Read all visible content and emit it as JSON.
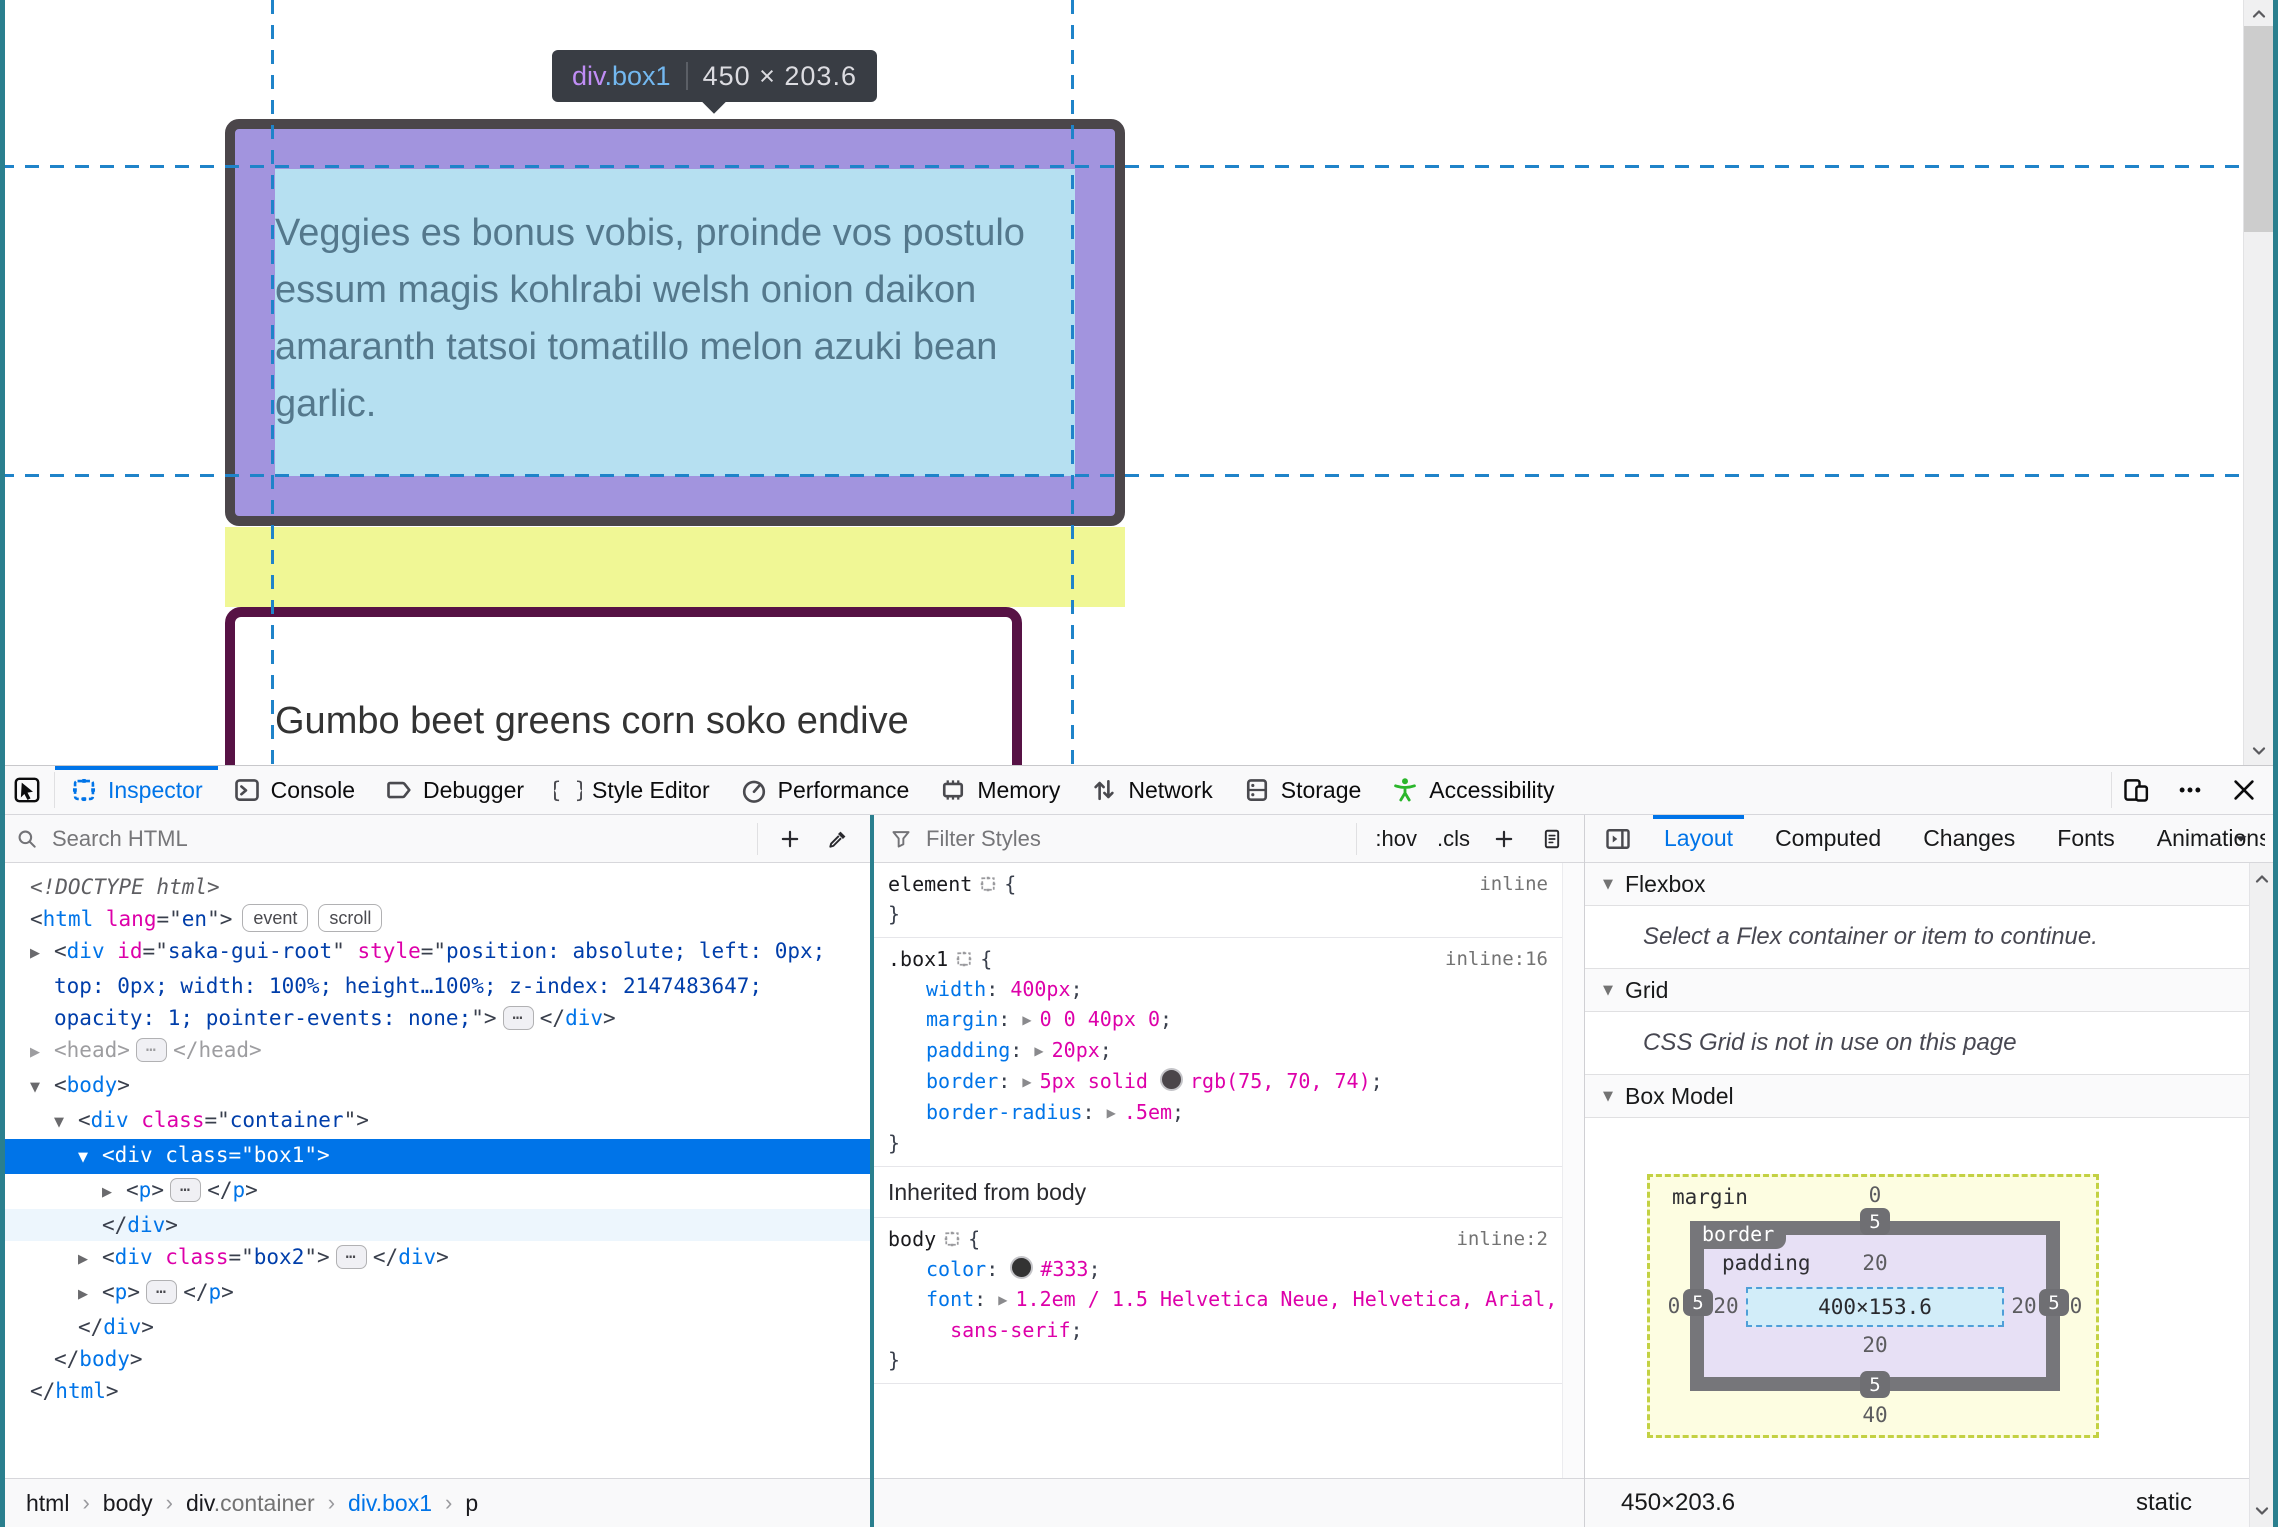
{
  "frame": {
    "edge_color": "#2a7f8e"
  },
  "page": {
    "tooltip": {
      "tag": "div",
      "class_name": ".box1",
      "size": "450 × 203.6"
    },
    "box1_text": "Veggies es bonus vobis, proinde vos postulo essum magis kohlrabi welsh onion daikon amaranth tatsoi tomatillo melon azuki bean garlic.",
    "box2_text": "Gumbo beet greens corn soko endive",
    "highlight_colors": {
      "padding": "#a294de",
      "content": "#b6e0f1",
      "margin": "#f0f795",
      "guide": "#1f83c9",
      "border": "#4b464a",
      "box2_border": "#571245"
    }
  },
  "toolbox": {
    "tabs": [
      {
        "id": "inspector",
        "label": "Inspector",
        "active": true
      },
      {
        "id": "console",
        "label": "Console"
      },
      {
        "id": "debugger",
        "label": "Debugger"
      },
      {
        "id": "style-editor",
        "label": "Style Editor"
      },
      {
        "id": "performance",
        "label": "Performance"
      },
      {
        "id": "memory",
        "label": "Memory"
      },
      {
        "id": "network",
        "label": "Network"
      },
      {
        "id": "storage",
        "label": "Storage"
      },
      {
        "id": "accessibility",
        "label": "Accessibility",
        "icon_color": "#2bb62b"
      }
    ],
    "window_controls": [
      "responsive-mode",
      "menu",
      "close"
    ]
  },
  "markup": {
    "search_placeholder": "Search HTML",
    "rows": [
      {
        "i": 0,
        "toks": [
          [
            "d",
            "<!DOCTYPE html>"
          ]
        ]
      },
      {
        "i": 0,
        "toks": [
          [
            "t",
            "<"
          ],
          [
            "g",
            "html"
          ],
          [
            "t",
            " "
          ],
          [
            "a",
            "lang"
          ],
          [
            "t",
            "=\""
          ],
          [
            "v",
            "en"
          ],
          [
            "t",
            "\">"
          ],
          [
            "b",
            "event"
          ],
          [
            "b",
            "scroll"
          ]
        ]
      },
      {
        "i": 1,
        "e": "c",
        "wrap": 1,
        "toks": [
          [
            "t",
            "<"
          ],
          [
            "g",
            "div"
          ],
          [
            "t",
            " "
          ],
          [
            "a",
            "id"
          ],
          [
            "t",
            "=\""
          ],
          [
            "v",
            "saka-gui-root"
          ],
          [
            "t",
            "\" "
          ],
          [
            "a",
            "style"
          ],
          [
            "t",
            "=\""
          ],
          [
            "v",
            "position: absolute; left: 0px; top: 0px; width: 100%; height…100%; z-index: 2147483647; opacity: 1; pointer-events: none;"
          ],
          [
            "t",
            "\">"
          ],
          [
            "p",
            "⋯"
          ],
          [
            "t",
            "</"
          ],
          [
            "g",
            "div"
          ],
          [
            "t",
            ">"
          ]
        ]
      },
      {
        "i": 1,
        "e": "c",
        "dim": 1,
        "toks": [
          [
            "t",
            "<"
          ],
          [
            "g",
            "head"
          ],
          [
            "t",
            ">"
          ],
          [
            "p",
            "⋯"
          ],
          [
            "t",
            "</"
          ],
          [
            "g",
            "head"
          ],
          [
            "t",
            ">"
          ]
        ]
      },
      {
        "i": 1,
        "e": "o",
        "toks": [
          [
            "t",
            "<"
          ],
          [
            "g",
            "body"
          ],
          [
            "t",
            ">"
          ]
        ]
      },
      {
        "i": 2,
        "e": "o",
        "toks": [
          [
            "t",
            "<"
          ],
          [
            "g",
            "div"
          ],
          [
            "t",
            " "
          ],
          [
            "a",
            "class"
          ],
          [
            "t",
            "=\""
          ],
          [
            "v",
            "container"
          ],
          [
            "t",
            "\">"
          ]
        ]
      },
      {
        "i": 3,
        "e": "o",
        "sel": 1,
        "toks": [
          [
            "t",
            "<"
          ],
          [
            "g",
            "div"
          ],
          [
            "t",
            " "
          ],
          [
            "a",
            "class"
          ],
          [
            "t",
            "=\""
          ],
          [
            "v",
            "box1"
          ],
          [
            "t",
            "\">"
          ]
        ]
      },
      {
        "i": 4,
        "e": "c",
        "toks": [
          [
            "t",
            "<"
          ],
          [
            "g",
            "p"
          ],
          [
            "t",
            ">"
          ],
          [
            "p",
            "⋯"
          ],
          [
            "t",
            "</"
          ],
          [
            "g",
            "p"
          ],
          [
            "t",
            ">"
          ]
        ]
      },
      {
        "i": 3,
        "aft": 1,
        "toks": [
          [
            "t",
            "</"
          ],
          [
            "g",
            "div"
          ],
          [
            "t",
            ">"
          ]
        ]
      },
      {
        "i": 3,
        "e": "c",
        "toks": [
          [
            "t",
            "<"
          ],
          [
            "g",
            "div"
          ],
          [
            "t",
            " "
          ],
          [
            "a",
            "class"
          ],
          [
            "t",
            "=\""
          ],
          [
            "v",
            "box2"
          ],
          [
            "t",
            "\">"
          ],
          [
            "p",
            "⋯"
          ],
          [
            "t",
            "</"
          ],
          [
            "g",
            "div"
          ],
          [
            "t",
            ">"
          ]
        ]
      },
      {
        "i": 3,
        "e": "c",
        "toks": [
          [
            "t",
            "<"
          ],
          [
            "g",
            "p"
          ],
          [
            "t",
            ">"
          ],
          [
            "p",
            "⋯"
          ],
          [
            "t",
            "</"
          ],
          [
            "g",
            "p"
          ],
          [
            "t",
            ">"
          ]
        ]
      },
      {
        "i": 2,
        "toks": [
          [
            "t",
            "</"
          ],
          [
            "g",
            "div"
          ],
          [
            "t",
            ">"
          ]
        ]
      },
      {
        "i": 1,
        "toks": [
          [
            "t",
            "</"
          ],
          [
            "g",
            "body"
          ],
          [
            "t",
            ">"
          ]
        ]
      },
      {
        "i": 0,
        "toks": [
          [
            "t",
            "</"
          ],
          [
            "g",
            "html"
          ],
          [
            "t",
            ">"
          ]
        ]
      }
    ]
  },
  "rules": {
    "filter_placeholder": "Filter Styles",
    "pseudo_button": ":hov",
    "class_button": ".cls",
    "sections": [
      {
        "rules": [
          {
            "selector": "element",
            "link": "inline",
            "props": [],
            "close": "}"
          },
          {
            "selector": ".box1",
            "link": "inline:16",
            "close": "}",
            "props": [
              {
                "n": "width",
                "v": [
                  "400px"
                ]
              },
              {
                "n": "margin",
                "a": true,
                "v": [
                  "0 0 40px 0"
                ]
              },
              {
                "n": "padding",
                "a": true,
                "v": [
                  "20px"
                ]
              },
              {
                "n": "border",
                "a": true,
                "v": [
                  "5px solid ",
                  {
                    "sw": "#4b464a"
                  },
                  "rgb(75, 70, 74)"
                ]
              },
              {
                "n": "border-radius",
                "a": true,
                "v": [
                  ".5em"
                ]
              }
            ]
          }
        ]
      },
      {
        "header": "Inherited from body",
        "rules": [
          {
            "selector": "body",
            "link": "inline:2",
            "close": "}",
            "props": [
              {
                "n": "color",
                "v": [
                  {
                    "sw": "#333333"
                  },
                  "#333"
                ]
              },
              {
                "n": "font",
                "a": true,
                "v": [
                  "1.2em / 1.5 Helvetica Neue, Helvetica, Arial, sans-serif"
                ]
              }
            ]
          }
        ]
      }
    ]
  },
  "layout": {
    "tabs": [
      {
        "label": "Layout",
        "active": true
      },
      {
        "label": "Computed"
      },
      {
        "label": "Changes"
      },
      {
        "label": "Fonts"
      },
      {
        "label": "Animations",
        "clipped": true
      }
    ],
    "sections": {
      "flexbox": {
        "title": "Flexbox",
        "message": "Select a Flex container or item to continue."
      },
      "grid": {
        "title": "Grid",
        "message": "CSS Grid is not in use on this page"
      },
      "boxmodel": {
        "title": "Box Model"
      }
    },
    "boxmodel": {
      "margin_label": "margin",
      "border_label": "border",
      "padding_label": "padding",
      "margin": {
        "top": "0",
        "right": "0",
        "bottom": "40",
        "left": "0"
      },
      "border": {
        "top": "5",
        "right": "5",
        "bottom": "5",
        "left": "5"
      },
      "padding": {
        "top": "20",
        "right": "20",
        "bottom": "20",
        "left": "20"
      },
      "content": "400×153.6"
    },
    "footer": {
      "dimensions": "450×203.6",
      "position": "static"
    }
  },
  "breadcrumb": [
    {
      "label": "html"
    },
    {
      "label": "body"
    },
    {
      "label": "div",
      "class_name": ".container"
    },
    {
      "label": "div.box1",
      "selected": true
    },
    {
      "label": "p"
    }
  ]
}
